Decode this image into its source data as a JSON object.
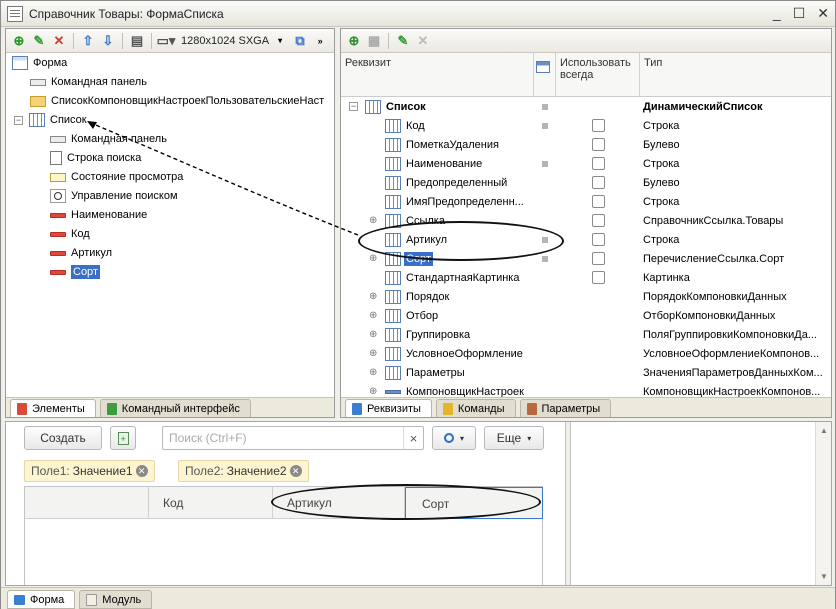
{
  "window": {
    "title": "Справочник Товары: ФормаСписка"
  },
  "left_toolbar": {
    "resolution": "1280x1024 SXGA"
  },
  "elements_tree": [
    {
      "label": "Форма",
      "icon": "form-icon"
    },
    {
      "label": "Командная панель",
      "icon": "command-panel-icon"
    },
    {
      "label": "СписокКомпоновщикНастроекПользовательскиеНаст",
      "icon": "folder-icon"
    },
    {
      "label": "Список",
      "icon": "table-icon"
    },
    {
      "label": "Командная панель",
      "icon": "command-panel-icon"
    },
    {
      "label": "Строка поиска",
      "icon": "search-string-icon"
    },
    {
      "label": "Состояние просмотра",
      "icon": "view-state-icon"
    },
    {
      "label": "Управление поиском",
      "icon": "search-control-icon"
    },
    {
      "label": "Наименование",
      "icon": "field-icon"
    },
    {
      "label": "Код",
      "icon": "field-icon"
    },
    {
      "label": "Артикул",
      "icon": "field-icon"
    },
    {
      "label": "Сорт",
      "icon": "field-icon"
    }
  ],
  "left_tabs": [
    "Элементы",
    "Командный интерфейс"
  ],
  "props_header": {
    "col1": "Реквизит",
    "col3": "Использовать всегда",
    "col4": "Тип"
  },
  "props": [
    {
      "name": "Список",
      "type": "ДинамическийСписок"
    },
    {
      "name": "Код",
      "type": "Строка"
    },
    {
      "name": "ПометкаУдаления",
      "type": "Булево"
    },
    {
      "name": "Наименование",
      "type": "Строка"
    },
    {
      "name": "Предопределенный",
      "type": "Булево"
    },
    {
      "name": "ИмяПредопределенн...",
      "type": "Строка"
    },
    {
      "name": "Ссылка",
      "type": "СправочникСсылка.Товары"
    },
    {
      "name": "Артикул",
      "type": "Строка"
    },
    {
      "name": "Сорт",
      "type": "ПеречислениеСсылка.Сорт"
    },
    {
      "name": "СтандартнаяКартинка",
      "type": "Картинка"
    },
    {
      "name": "Порядок",
      "type": "ПорядокКомпоновкиДанных"
    },
    {
      "name": "Отбор",
      "type": "ОтборКомпоновкиДанных"
    },
    {
      "name": "Группировка",
      "type": "ПоляГруппировкиКомпоновкиДа..."
    },
    {
      "name": "УсловноеОформление",
      "type": "УсловноеОформлениеКомпонов..."
    },
    {
      "name": "Параметры",
      "type": "ЗначенияПараметровДанныхКом..."
    },
    {
      "name": "КомпоновщикНастроек",
      "type": "КомпоновщикНастроекКомпонов..."
    }
  ],
  "right_tabs": [
    "Реквизиты",
    "Команды",
    "Параметры"
  ],
  "preview": {
    "create": "Создать",
    "search_placeholder": "Поиск (Ctrl+F)",
    "search_clear": "×",
    "more": "Еще",
    "chip1_label": "Поле1:",
    "chip1_value": "Значение1",
    "chip2_label": "Поле2:",
    "chip2_value": "Значение2",
    "columns": [
      "Код",
      "Артикул",
      "Сорт"
    ]
  },
  "bottom_tabs": [
    "Форма",
    "Модуль"
  ]
}
